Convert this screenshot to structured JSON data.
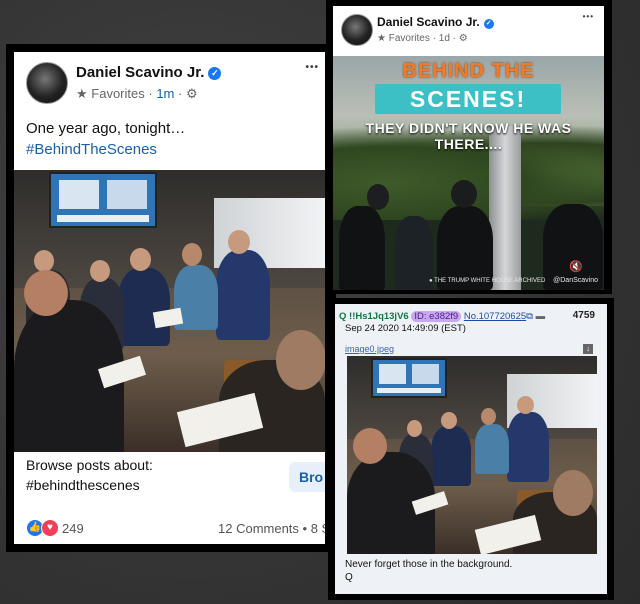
{
  "left_post": {
    "author": "Daniel Scavino Jr.",
    "audience": "Favorites",
    "time": "1m",
    "text_line1": "One year ago, tonight…",
    "hashtag": "#BehindTheScenes",
    "browse_label": "Browse posts about:",
    "browse_tag": "#behindthescenes",
    "browse_button": "Bro",
    "reaction_count": "249",
    "comments": "12 Comments • 8 S",
    "menu": "•••"
  },
  "video_post": {
    "author": "Daniel Scavino Jr.",
    "audience": "Favorites",
    "time": "1d",
    "banner_line1": "BEHIND THE",
    "banner_line2": "SCENES!",
    "banner_line3": "THEY DIDN'T KNOW HE WAS THERE....",
    "watermark_left": "● THE TRUMP WHITE HOUSE ARCHIVED",
    "watermark_right": "@DanScavino",
    "menu": "•••"
  },
  "q_post": {
    "name": "Q !!Hs1Jq13jV6",
    "id": "ID: e382f9",
    "number": "No.107720625",
    "reply_count": "4759",
    "datetime": "Sep 24 2020 14:49:09 (EST)",
    "filename": "image0.jpeg",
    "message": "Never forget those in the background.",
    "signature": "Q"
  },
  "colors": {
    "facebook_blue": "#1877f2",
    "hashtag_blue": "#1b5fa8",
    "banner_orange": "#f07c2a",
    "banner_teal": "#3cc0c6",
    "q_name_green": "#117743",
    "q_id_purple": "#c9a6f0"
  },
  "icons": [
    "verified-badge-icon",
    "globe-star-icon",
    "gear-icon",
    "more-dots-icon",
    "like-reaction-icon",
    "love-reaction-icon",
    "mute-icon",
    "folder-icon",
    "download-icon",
    "external-link-icon"
  ]
}
